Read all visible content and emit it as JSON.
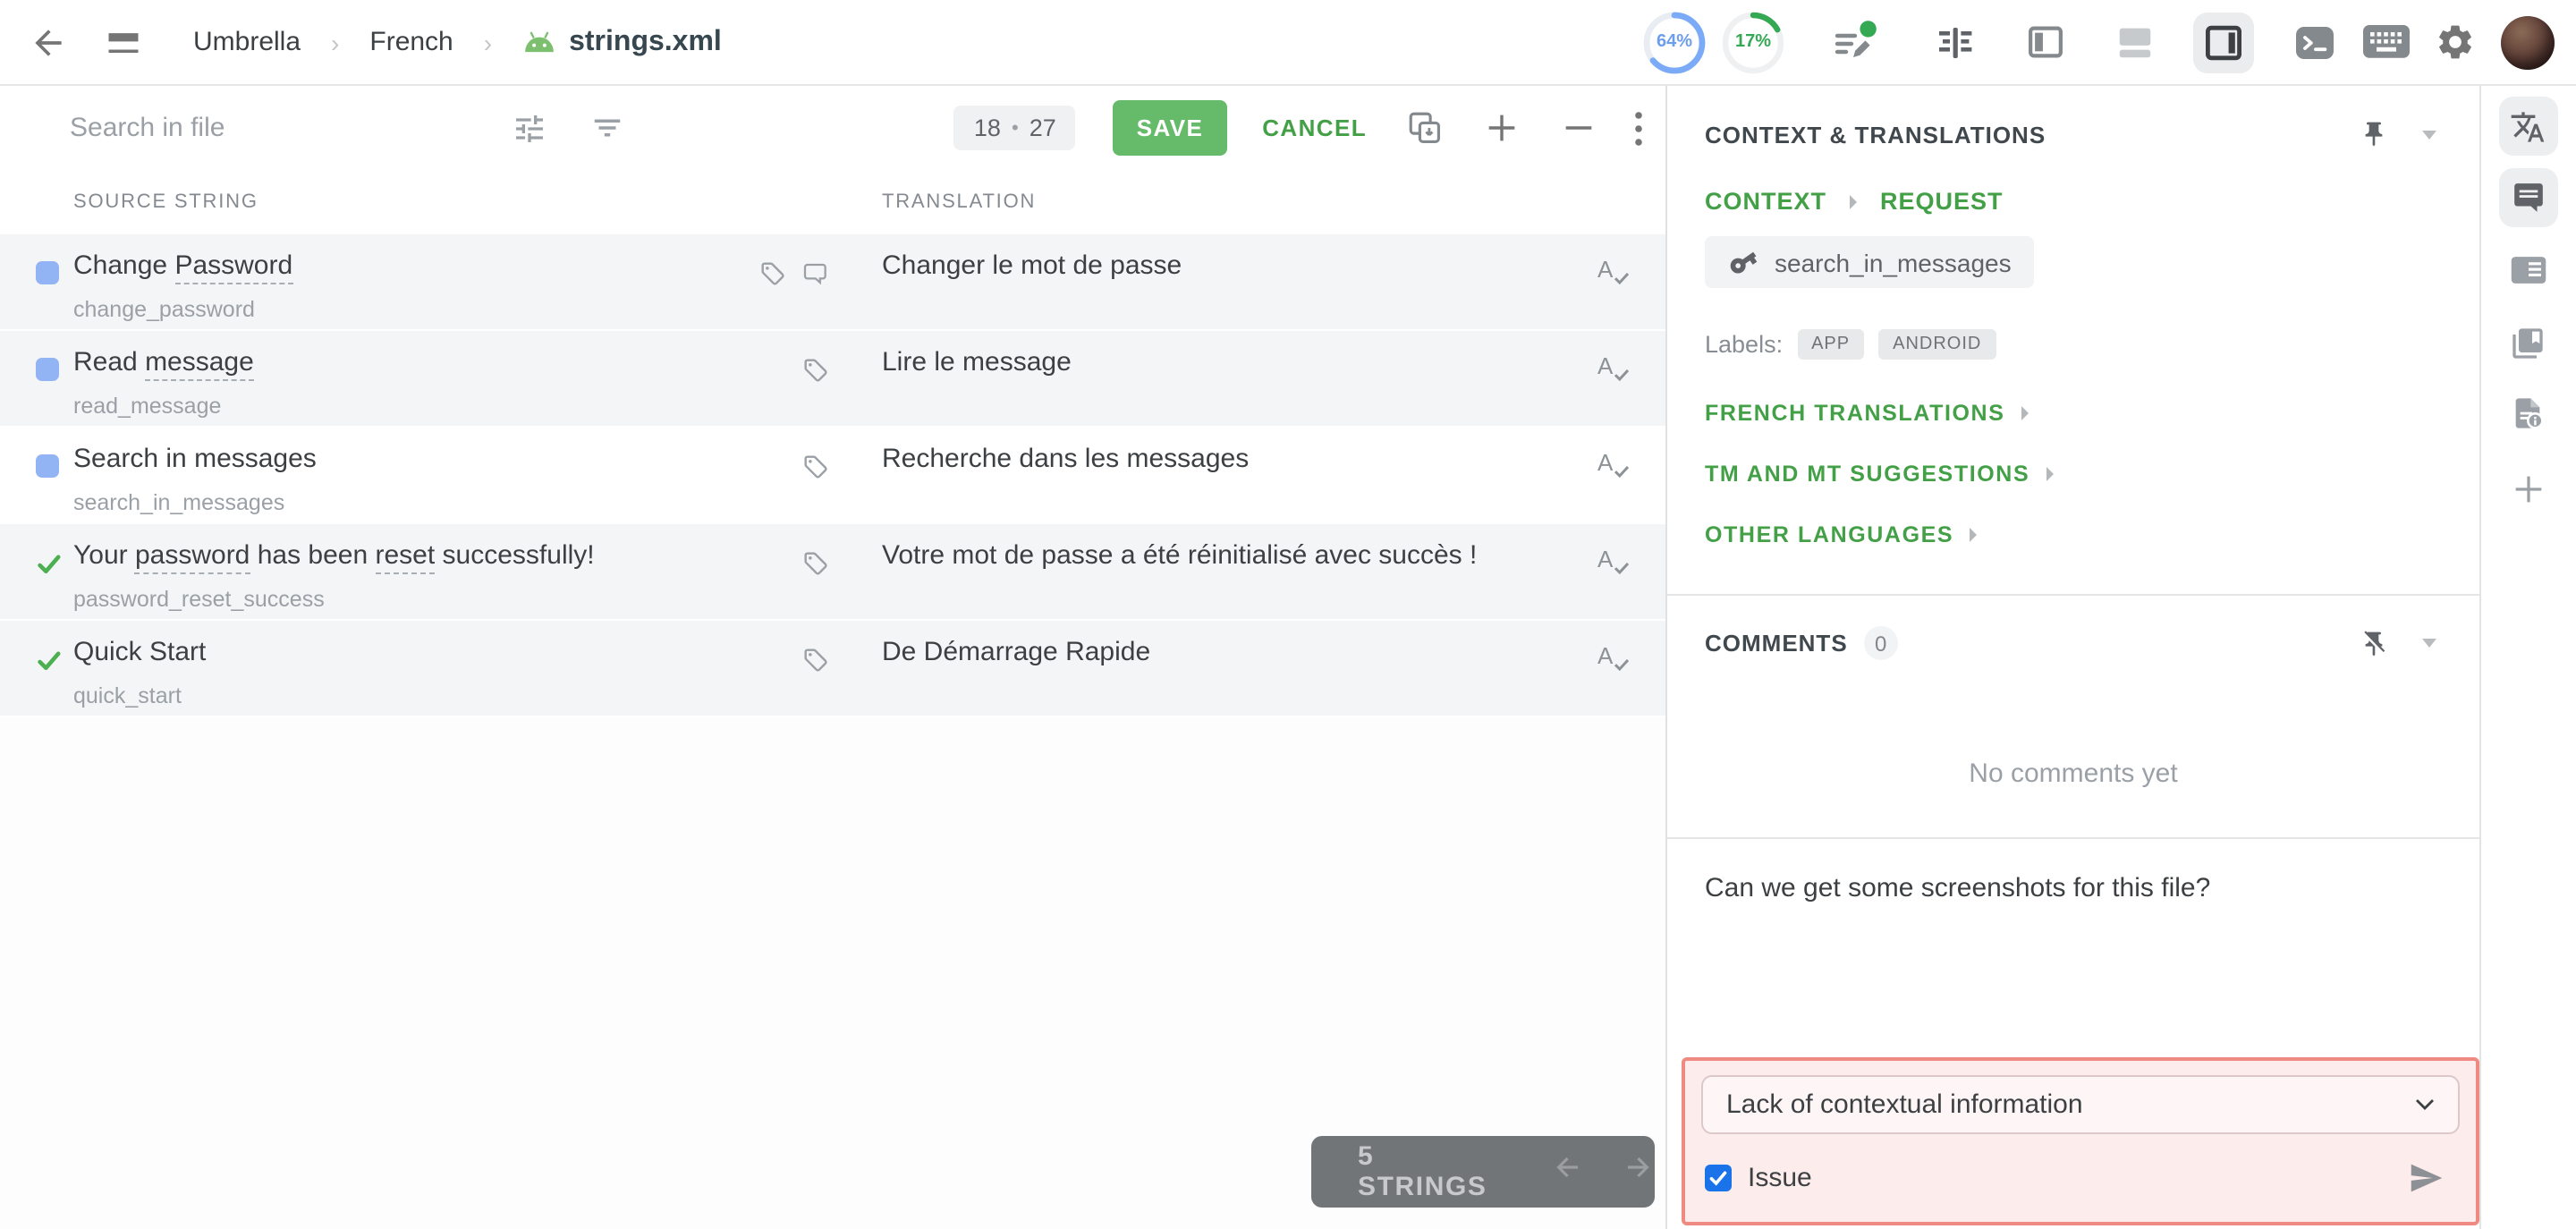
{
  "colors": {
    "accent_green": "#43a047",
    "save_green": "#66bb6a",
    "issue_border": "#ef8a80",
    "issue_bg": "#fdecec",
    "checkbox_blue": "#1a73e8",
    "progress_blue": "#6d9eeb",
    "progress_green": "#34a853",
    "status_blue": "#92b4f4",
    "status_green": "#4caf50"
  },
  "topbar": {
    "project": "Umbrella",
    "language": "French",
    "file": "strings.xml",
    "progress_translated": "64%",
    "progress_approved": "17%"
  },
  "toolbar": {
    "search_placeholder": "Search in file",
    "count_current": "18",
    "count_separator": "•",
    "count_total": "27",
    "save_label": "SAVE",
    "cancel_label": "CANCEL"
  },
  "table": {
    "col_source": "SOURCE STRING",
    "col_translation": "TRANSLATION",
    "rows": [
      {
        "status": "translated",
        "selected": false,
        "source": [
          {
            "t": "Change "
          },
          {
            "t": "Password",
            "term": true
          }
        ],
        "key": "change_password",
        "translation": "Changer le mot de passe",
        "icons": [
          "tag",
          "comment"
        ]
      },
      {
        "status": "translated",
        "selected": false,
        "source": [
          {
            "t": "Read "
          },
          {
            "t": "message",
            "term": true
          }
        ],
        "key": "read_message",
        "translation": "Lire le message",
        "icons": [
          "tag"
        ]
      },
      {
        "status": "translated",
        "selected": true,
        "source": [
          {
            "t": "Search in messages"
          }
        ],
        "key": "search_in_messages",
        "translation": "Recherche dans les messages",
        "icons": [
          "tag"
        ]
      },
      {
        "status": "approved",
        "selected": false,
        "source": [
          {
            "t": "Your "
          },
          {
            "t": "password",
            "term": true
          },
          {
            "t": " has been "
          },
          {
            "t": "reset",
            "term": true
          },
          {
            "t": " successfully!"
          }
        ],
        "key": "password_reset_success",
        "translation": "Votre mot de passe a été réinitialisé avec succès !",
        "icons": [
          "tag"
        ]
      },
      {
        "status": "approved",
        "selected": false,
        "source": [
          {
            "t": "Quick Start"
          }
        ],
        "key": "quick_start",
        "translation": "De Démarrage Rapide",
        "icons": [
          "tag"
        ]
      }
    ]
  },
  "panel": {
    "title": "CONTEXT & TRANSLATIONS",
    "context_label": "CONTEXT",
    "request_label": "REQUEST",
    "string_key": "search_in_messages",
    "labels_caption": "Labels:",
    "labels": [
      "APP",
      "ANDROID"
    ],
    "sections": [
      "FRENCH TRANSLATIONS",
      "TM AND MT SUGGESTIONS",
      "OTHER LANGUAGES"
    ],
    "comments_title": "COMMENTS",
    "comments_count": "0",
    "comments_empty": "No comments yet",
    "comment_draft": "Can we get some screenshots for this file?",
    "issue_type": "Lack of contextual information",
    "issue_checkbox_label": "Issue",
    "issue_checked": true
  },
  "footer": {
    "strings_count": "5 STRINGS"
  }
}
